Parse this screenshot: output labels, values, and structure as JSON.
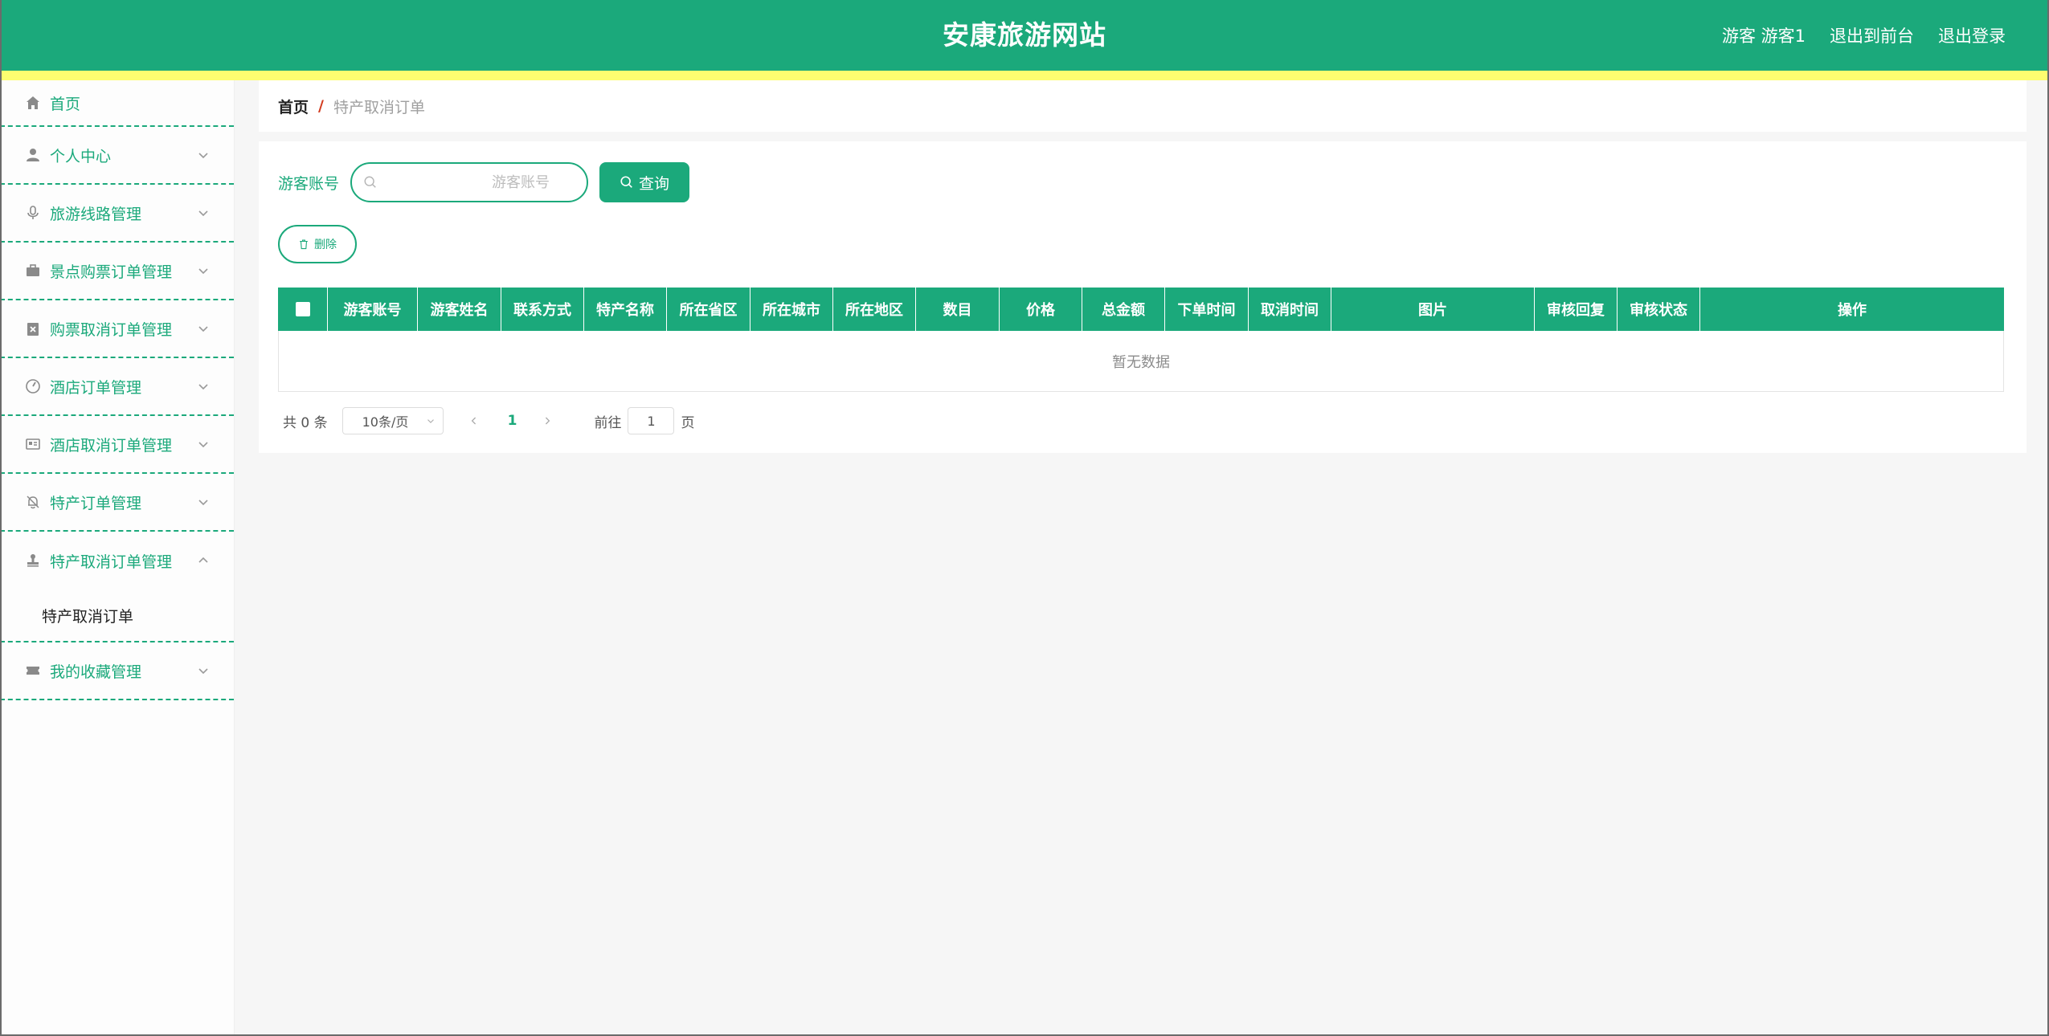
{
  "header": {
    "title": "安康旅游网站",
    "user": "游客 游客1",
    "to_frontend": "退出到前台",
    "logout": "退出登录"
  },
  "sidebar": {
    "items": [
      {
        "label": "首页",
        "icon": "home-icon"
      },
      {
        "label": "个人中心",
        "icon": "user-icon"
      },
      {
        "label": "旅游线路管理",
        "icon": "microphone-icon"
      },
      {
        "label": "景点购票订单管理",
        "icon": "briefcase-icon"
      },
      {
        "label": "购票取消订单管理",
        "icon": "clipboard-x-icon"
      },
      {
        "label": "酒店订单管理",
        "icon": "gauge-icon"
      },
      {
        "label": "酒店取消订单管理",
        "icon": "id-card-icon"
      },
      {
        "label": "特产订单管理",
        "icon": "bell-off-icon"
      },
      {
        "label": "特产取消订单管理",
        "icon": "stamp-icon"
      },
      {
        "label": "我的收藏管理",
        "icon": "ticket-icon"
      }
    ],
    "submenu": {
      "label": "特产取消订单"
    }
  },
  "breadcrumb": {
    "home": "首页",
    "separator": "/",
    "current": "特产取消订单"
  },
  "search": {
    "label": "游客账号",
    "placeholder": "游客账号",
    "query_label": "查询"
  },
  "toolbar": {
    "delete_label": "删除"
  },
  "table": {
    "columns": [
      "游客账号",
      "游客姓名",
      "联系方式",
      "特产名称",
      "所在省区",
      "所在城市",
      "所在地区",
      "数目",
      "价格",
      "总金额",
      "下单时间",
      "取消时间",
      "图片",
      "审核回复",
      "审核状态",
      "操作"
    ],
    "empty_text": "暂无数据"
  },
  "pagination": {
    "total_text": "共 0 条",
    "page_size": "10条/页",
    "current_page": "1",
    "goto_label": "前往",
    "goto_value": "1",
    "page_suffix": "页"
  },
  "colors": {
    "primary": "#1ba97b",
    "accent_bar": "#fdfd70",
    "breadcrumb_separator": "#d23b1f"
  }
}
